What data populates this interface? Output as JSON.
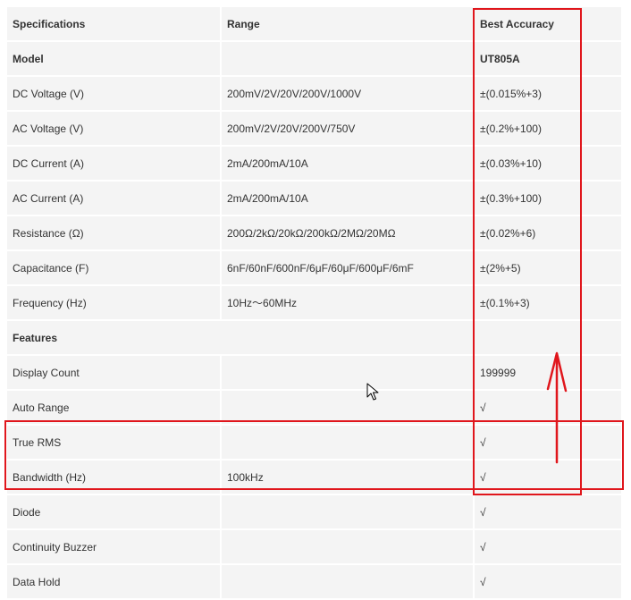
{
  "header": {
    "specifications": "Specifications",
    "range": "Range",
    "best_accuracy": "Best Accuracy"
  },
  "rows": [
    {
      "spec": "Model",
      "range": "",
      "accuracy": "UT805A",
      "bold": true
    },
    {
      "spec": "DC Voltage (V)",
      "range": "200mV/2V/20V/200V/1000V",
      "accuracy": "±(0.015%+3)"
    },
    {
      "spec": "AC Voltage (V)",
      "range": "200mV/2V/20V/200V/750V",
      "accuracy": "±(0.2%+100)"
    },
    {
      "spec": "DC Current (A)",
      "range": "2mA/200mA/10A",
      "accuracy": "±(0.03%+10)"
    },
    {
      "spec": "AC Current (A)",
      "range": "2mA/200mA/10A",
      "accuracy": "±(0.3%+100)"
    },
    {
      "spec": "Resistance (Ω)",
      "range": "200Ω/2kΩ/20kΩ/200kΩ/2MΩ/20MΩ",
      "accuracy": "±(0.02%+6)"
    },
    {
      "spec": "Capacitance (F)",
      "range": "6nF/60nF/600nF/6μF/60μF/600μF/6mF",
      "accuracy": "±(2%+5)"
    },
    {
      "spec": "Frequency (Hz)",
      "range": "10Hz～60MHz",
      "accuracy": "±(0.1%+3)"
    }
  ],
  "features_heading": "Features",
  "features": [
    {
      "spec": "Display Count",
      "range": "",
      "accuracy": "199999"
    },
    {
      "spec": "Auto Range",
      "range": "",
      "accuracy": "√"
    },
    {
      "spec": "True RMS",
      "range": "",
      "accuracy": "√"
    },
    {
      "spec": "Bandwidth (Hz)",
      "range": "100kHz",
      "accuracy": "√"
    },
    {
      "spec": "Diode",
      "range": "",
      "accuracy": "√"
    },
    {
      "spec": "Continuity Buzzer",
      "range": "",
      "accuracy": "√"
    },
    {
      "spec": "Data Hold",
      "range": "",
      "accuracy": "√"
    }
  ],
  "colors": {
    "annotation": "#e0161c",
    "cell_background": "#f4f4f4",
    "text": "#333333"
  },
  "icons": {
    "cursor": "mouse-pointer-icon",
    "arrow": "up-arrow-annotation-icon"
  }
}
